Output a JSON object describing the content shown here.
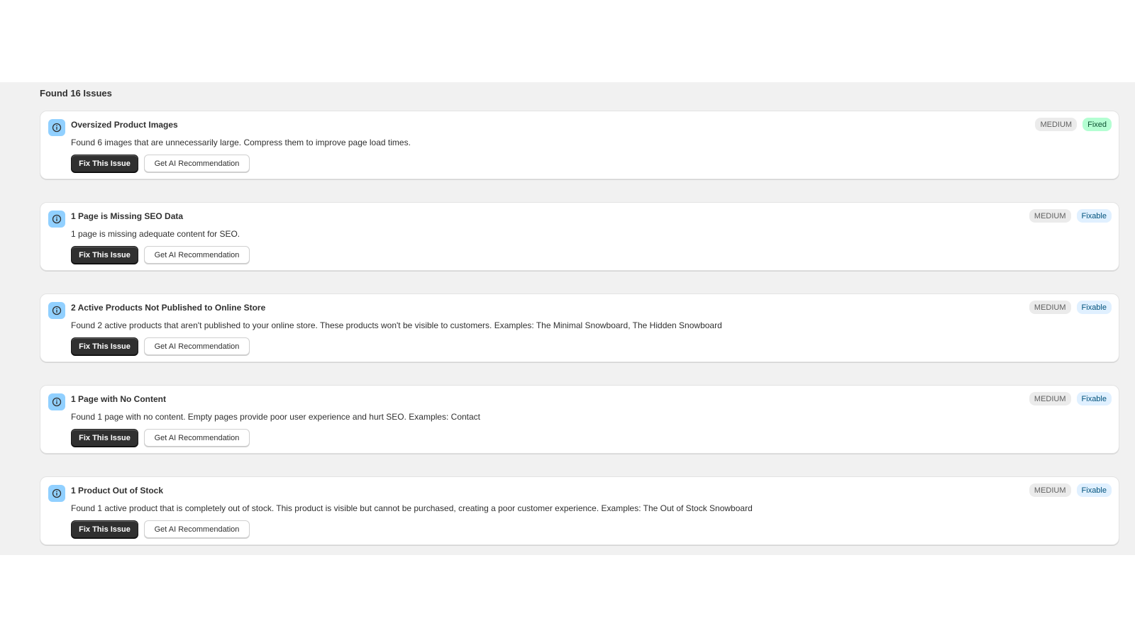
{
  "heading": "Found 16 Issues",
  "icon": "info-icon",
  "buttons": {
    "fix_label": "Fix This Issue",
    "ai_label": "Get AI Recommendation"
  },
  "issues": [
    {
      "title": "Oversized Product Images",
      "description": "Found 6 images that are unnecessarily large. Compress them to improve page load times.",
      "severity": "MEDIUM",
      "status": "Fixed"
    },
    {
      "title": "1 Page is Missing SEO Data",
      "description": "1 page is missing adequate content for SEO.",
      "severity": "MEDIUM",
      "status": "Fixable"
    },
    {
      "title": "2 Active Products Not Published to Online Store",
      "description": "Found 2 active products that aren't published to your online store. These products won't be visible to customers. Examples: The Minimal Snowboard, The Hidden Snowboard",
      "severity": "MEDIUM",
      "status": "Fixable"
    },
    {
      "title": "1 Page with No Content",
      "description": "Found 1 page with no content. Empty pages provide poor user experience and hurt SEO. Examples: Contact",
      "severity": "MEDIUM",
      "status": "Fixable"
    },
    {
      "title": "1 Product Out of Stock",
      "description": "Found 1 active product that is completely out of stock. This product is visible but cannot be purchased, creating a poor customer experience. Examples: The Out of Stock Snowboard",
      "severity": "MEDIUM",
      "status": "Fixable"
    }
  ],
  "colors": {
    "panel_bg": "#f1f1f1",
    "icon_bg": "#91d0ff",
    "fixed_badge_bg": "#b4fed2",
    "fixable_badge_bg": "#e0f0ff",
    "primary_button_bg": "#303030"
  }
}
